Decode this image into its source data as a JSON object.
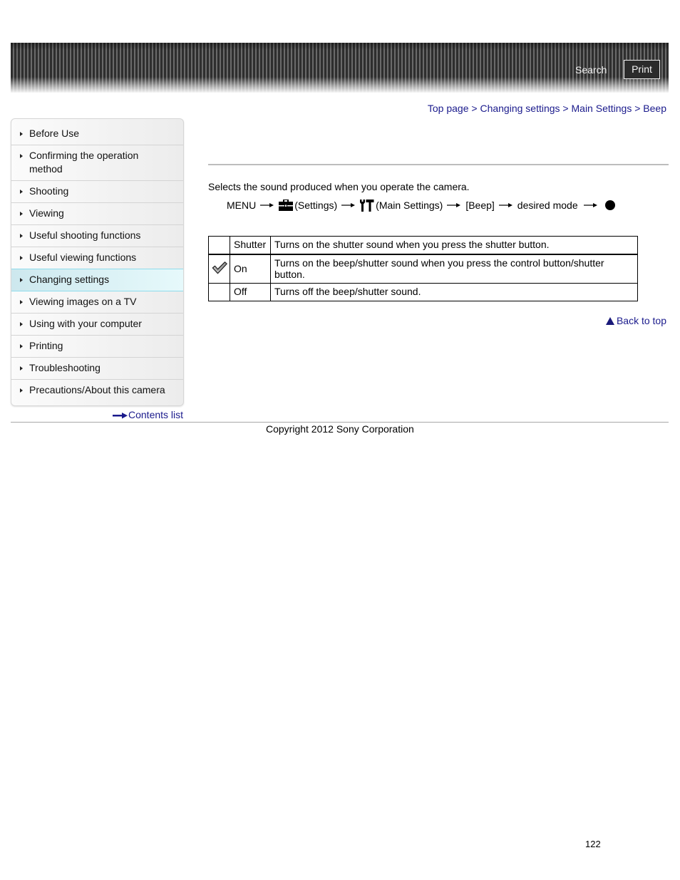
{
  "header": {
    "search_label": "Search",
    "print_label": "Print"
  },
  "breadcrumb": [
    {
      "label": "Top page"
    },
    {
      "label": "Changing settings"
    },
    {
      "label": "Main Settings"
    },
    {
      "label": "Beep"
    }
  ],
  "breadcrumb_separator": ">",
  "sidebar": {
    "items": [
      {
        "label": "Before Use",
        "active": false
      },
      {
        "label": "Confirming the operation method",
        "active": false
      },
      {
        "label": "Shooting",
        "active": false
      },
      {
        "label": "Viewing",
        "active": false
      },
      {
        "label": "Useful shooting functions",
        "active": false
      },
      {
        "label": "Useful viewing functions",
        "active": false
      },
      {
        "label": "Changing settings",
        "active": true
      },
      {
        "label": "Viewing images on a TV",
        "active": false
      },
      {
        "label": "Using with your computer",
        "active": false
      },
      {
        "label": "Printing",
        "active": false
      },
      {
        "label": "Troubleshooting",
        "active": false
      },
      {
        "label": "Precautions/About this camera",
        "active": false
      }
    ],
    "contents_link": "Contents list"
  },
  "main": {
    "description": "Selects the sound produced when you operate the camera.",
    "menu_path": {
      "menu": "MENU",
      "settings_icon": "toolbox-icon",
      "settings": "(Settings)",
      "main_settings_icon": "wrench-hammer-icon",
      "main_settings": "(Main Settings)",
      "beep": "[Beep]",
      "desired_mode": "desired mode",
      "confirm_icon": "center-button-icon"
    },
    "options": [
      {
        "default": false,
        "name": "Shutter",
        "description": "Turns on the shutter sound when you press the shutter button."
      },
      {
        "default": true,
        "name": "On",
        "description": "Turns on the beep/shutter sound when you press the control button/shutter button."
      },
      {
        "default": false,
        "name": "Off",
        "description": "Turns off the beep/shutter sound."
      }
    ],
    "back_to_top": "Back to top"
  },
  "footer": {
    "copyright": "Copyright 2012 Sony Corporation",
    "page_number": "122"
  }
}
